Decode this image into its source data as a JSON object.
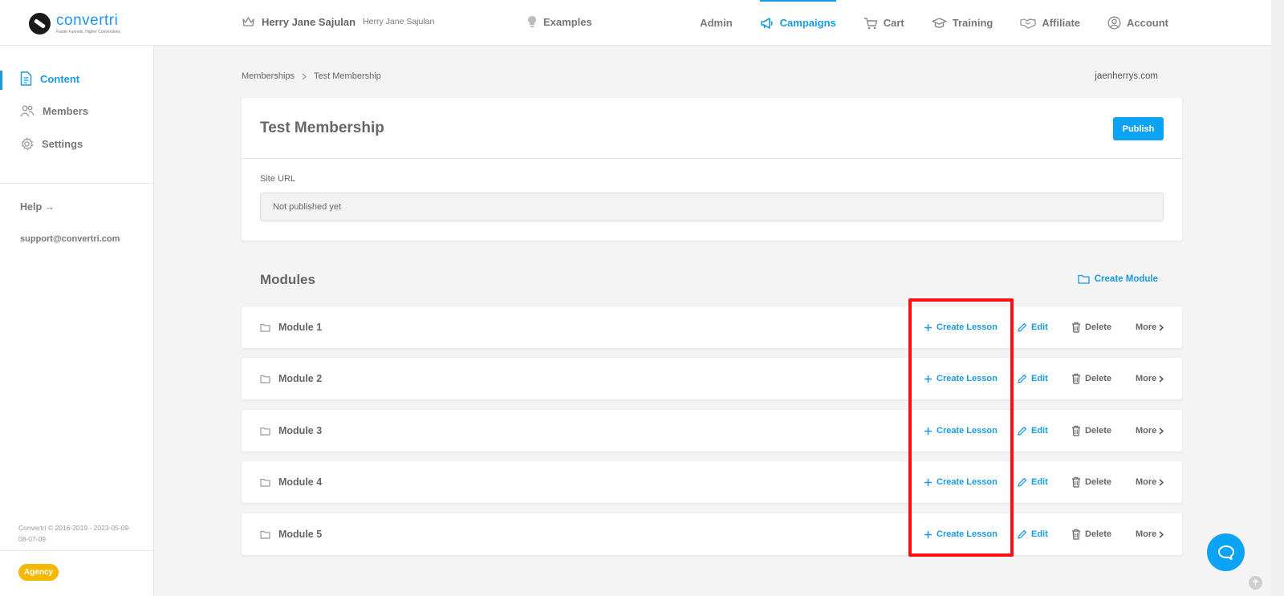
{
  "header": {
    "logo_name": "convertri",
    "logo_tagline": "Faster Funnels, Higher Conversions",
    "user_name": "Herry Jane Sajulan",
    "user_subtitle": "Herry Jane Sajulan",
    "examples_label": "Examples",
    "nav": [
      {
        "label": "Admin",
        "icon": "none",
        "active": false
      },
      {
        "label": "Campaigns",
        "icon": "megaphone-icon",
        "active": true
      },
      {
        "label": "Cart",
        "icon": "cart-icon",
        "active": false
      },
      {
        "label": "Training",
        "icon": "graduation-cap-icon",
        "active": false
      },
      {
        "label": "Affiliate",
        "icon": "handshake-icon",
        "active": false
      },
      {
        "label": "Account",
        "icon": "user-circle-icon",
        "active": false
      }
    ]
  },
  "sidebar": {
    "items": [
      {
        "label": "Content",
        "icon": "document-icon",
        "active": true
      },
      {
        "label": "Members",
        "icon": "people-icon",
        "active": false
      },
      {
        "label": "Settings",
        "icon": "gear-icon",
        "active": false
      }
    ],
    "help_label": "Help →",
    "support_email": "support@convertri.com",
    "copyright": "Convertri © 2016-2019 - 2023-05-09-08-07-09",
    "badge": "Agency"
  },
  "breadcrumb": {
    "parent": "Memberships",
    "current": "Test Membership"
  },
  "domain": "jaenherrys.com",
  "membership": {
    "title": "Test Membership",
    "publish_label": "Publish",
    "site_url_label": "Site URL",
    "site_url_value": "Not published yet"
  },
  "modules": {
    "title": "Modules",
    "create_module_label": "Create Module",
    "actions": {
      "create_lesson": "Create Lesson",
      "edit": "Edit",
      "delete": "Delete",
      "more": "More"
    },
    "items": [
      {
        "name": "Module 1"
      },
      {
        "name": "Module 2"
      },
      {
        "name": "Module 3"
      },
      {
        "name": "Module 4"
      },
      {
        "name": "Module 5"
      }
    ]
  },
  "colors": {
    "accent": "#1a9ae0",
    "publish": "#0aa3f5",
    "highlight": "#ff1010",
    "badge": "#f5b800"
  }
}
